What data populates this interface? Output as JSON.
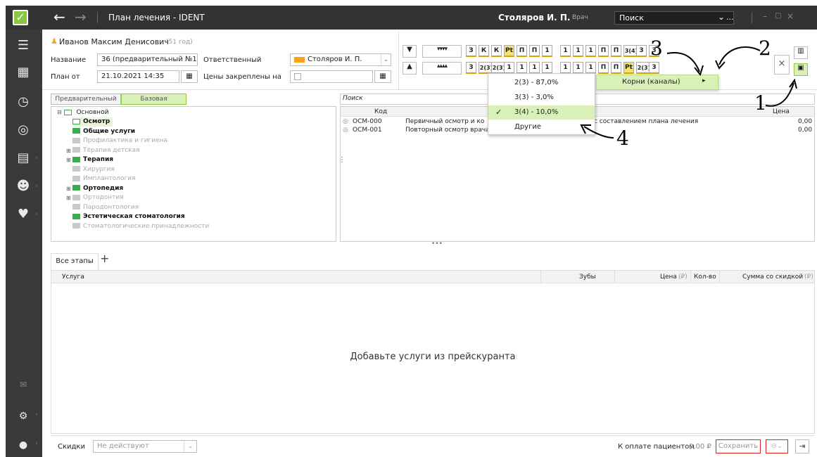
{
  "titlebar": {
    "app_title": "План лечения - IDENT",
    "user_name": "Столяров И. П.",
    "user_role": "Врач",
    "search_placeholder": "Поиск",
    "search_more": "..."
  },
  "patient": {
    "name": "Иванов Максим Денисович",
    "age": "(51 год)",
    "name_label": "Название",
    "name_value": "36 (предварительный №1)",
    "responsible_label": "Ответственный",
    "responsible_value": "Столяров И. П.",
    "plan_from_label": "План от",
    "plan_from_value": "21.10.2021 14:35",
    "prices_fixed_label": "Цены закреплены на",
    "responsible_color": "#f7a21c"
  },
  "teeth": {
    "upper": [
      "З",
      "К",
      "К",
      "Pt",
      "П",
      "П",
      "1",
      "1",
      "1",
      "1",
      "П",
      "П",
      "3(4)",
      "3",
      "3"
    ],
    "lower": [
      "3",
      "2(3)",
      "2(3)",
      "1",
      "1",
      "1",
      "1",
      "1",
      "1",
      "1",
      "П",
      "П",
      "Pt",
      "2(3)",
      "3"
    ]
  },
  "price_tabs": {
    "preliminary": "Предварительный",
    "base": "Базовая"
  },
  "tree": {
    "root": "Основной",
    "items": [
      {
        "label": "Осмотр",
        "style": "open",
        "selected": true
      },
      {
        "label": "Общие услуги",
        "style": "green"
      },
      {
        "label": "Профилактика и гигиена",
        "style": "gray"
      },
      {
        "label": "Терапия детская",
        "style": "gray",
        "expandable": true
      },
      {
        "label": "Терапия",
        "style": "green",
        "expandable": true
      },
      {
        "label": "Хирургия",
        "style": "gray"
      },
      {
        "label": "Имплантология",
        "style": "gray"
      },
      {
        "label": "Ортопедия",
        "style": "green",
        "expandable": true
      },
      {
        "label": "Ортодонтия",
        "style": "gray",
        "expandable": true
      },
      {
        "label": "Пародонтология",
        "style": "gray"
      },
      {
        "label": "Эстетическая стоматология",
        "style": "green"
      },
      {
        "label": "Стоматологические принадлежности",
        "style": "gray"
      }
    ]
  },
  "services": {
    "search_placeholder": "Поиск",
    "col_code": "Код",
    "col_price": "Цена",
    "rows": [
      {
        "code": "ОСМ-000",
        "name": "Первичный осмотр и ко",
        "name_tail": "с составлением плана лечения",
        "price": "0,00"
      },
      {
        "code": "ОСМ-001",
        "name": "Повторный осмотр врача-стоматолога",
        "name_tail": "",
        "price": "0,00"
      }
    ]
  },
  "context_menu": {
    "items": [
      "2(3) - 87,0%",
      "3(3) - 3,0%",
      "3(4) - 10,0%",
      "Другие"
    ],
    "checked_index": 2,
    "parent_label": "Корни (каналы)"
  },
  "stages": {
    "tab_all": "Все этапы",
    "add": "+"
  },
  "plan_table": {
    "col_service": "Услуга",
    "col_teeth": "Зубы",
    "col_price": "Цена",
    "col_price_unit": "(₽)",
    "col_qty": "Кол-во",
    "col_sum": "Сумма со скидкой",
    "col_sum_unit": "(₽)",
    "empty_message": "Добавьте услуги из прейскуранта"
  },
  "footer": {
    "discounts_label": "Скидки",
    "discounts_value": "Не действуют",
    "to_pay_label": "К оплате пациентом",
    "to_pay_value": "0,00 ₽",
    "save_label": "Сохранить"
  },
  "annotations": [
    "1",
    "2",
    "3",
    "4"
  ],
  "colors": {
    "accent_green": "#8dc63f",
    "highlight_green": "#d9f0b8",
    "titlebar": "#333333",
    "sidebar": "#3a3a3a"
  }
}
